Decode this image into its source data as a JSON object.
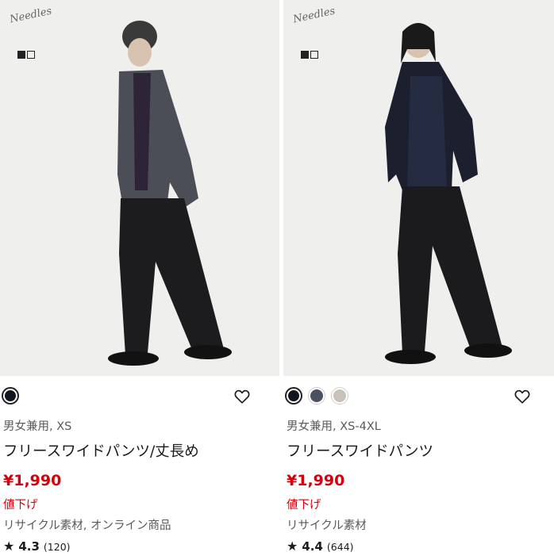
{
  "products": [
    {
      "brand_mark": "Needles",
      "gender_size": "男女兼用, XS",
      "name": "フリースワイドパンツ/丈長め",
      "price": "¥1,990",
      "price_label": "値下げ",
      "tags": "リサイクル素材, オンライン商品",
      "rating": "4.3",
      "review_count": "(120)",
      "colors": [
        "#121620"
      ]
    },
    {
      "brand_mark": "Needles",
      "gender_size": "男女兼用, XS-4XL",
      "name": "フリースワイドパンツ",
      "price": "¥1,990",
      "price_label": "値下げ",
      "tags": "リサイクル素材",
      "rating": "4.4",
      "review_count": "(644)",
      "colors": [
        "#121620",
        "#4a5160",
        "#c8c2b8"
      ]
    }
  ],
  "icons": {
    "favorite": "heart-outline-icon",
    "rating": "star-icon",
    "logo": "uniqlo-logo-icon"
  },
  "colors": {
    "accent_price": "#d7000f",
    "text_primary": "#1b1b1b",
    "text_secondary": "#595959"
  }
}
